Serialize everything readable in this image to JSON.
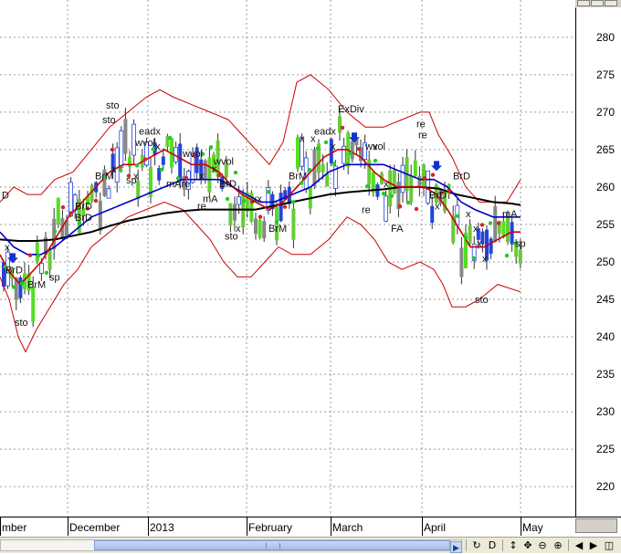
{
  "chart_data": {
    "type": "candlestick",
    "y_axis": {
      "range": [
        216,
        284
      ],
      "ticks": [
        220,
        225,
        230,
        235,
        240,
        245,
        250,
        255,
        260,
        265,
        270,
        275,
        280
      ]
    },
    "x_axis": {
      "labels": [
        "mber",
        "December",
        "2013",
        "February",
        "March",
        "April",
        "May"
      ]
    },
    "grid": "dotted",
    "series": [
      {
        "role": "price",
        "style": "candles"
      },
      {
        "role": "fast_ma",
        "color": "#cc0000",
        "points": [
          [
            0,
            251
          ],
          [
            8,
            249
          ],
          [
            15,
            248
          ],
          [
            22,
            247
          ],
          [
            30,
            248
          ],
          [
            45,
            250
          ],
          [
            60,
            253
          ],
          [
            75,
            256
          ],
          [
            90,
            258
          ],
          [
            105,
            260
          ],
          [
            120,
            262
          ],
          [
            135,
            263
          ],
          [
            150,
            263
          ],
          [
            165,
            264
          ],
          [
            180,
            265
          ],
          [
            195,
            264
          ],
          [
            210,
            263
          ],
          [
            225,
            263
          ],
          [
            240,
            262
          ],
          [
            255,
            260
          ],
          [
            265,
            259
          ],
          [
            280,
            258
          ],
          [
            295,
            257
          ],
          [
            310,
            258
          ],
          [
            325,
            260
          ],
          [
            340,
            262
          ],
          [
            355,
            264
          ],
          [
            370,
            265
          ],
          [
            380,
            265
          ],
          [
            395,
            264
          ],
          [
            410,
            262
          ],
          [
            420,
            261
          ],
          [
            435,
            260
          ],
          [
            450,
            260
          ],
          [
            465,
            260
          ],
          [
            478,
            259
          ],
          [
            490,
            257
          ],
          [
            505,
            254
          ],
          [
            515,
            252
          ],
          [
            530,
            252
          ],
          [
            545,
            253
          ],
          [
            560,
            254
          ],
          [
            570,
            254
          ]
        ]
      },
      {
        "role": "mid_ma",
        "color": "#0000cc",
        "points": [
          [
            0,
            254
          ],
          [
            15,
            252
          ],
          [
            30,
            251
          ],
          [
            45,
            251
          ],
          [
            60,
            252
          ],
          [
            80,
            254
          ],
          [
            100,
            256
          ],
          [
            120,
            257
          ],
          [
            140,
            258
          ],
          [
            160,
            259
          ],
          [
            180,
            260
          ],
          [
            200,
            261
          ],
          [
            220,
            261
          ],
          [
            240,
            261
          ],
          [
            255,
            260
          ],
          [
            270,
            259
          ],
          [
            285,
            258
          ],
          [
            300,
            258
          ],
          [
            320,
            259
          ],
          [
            340,
            260
          ],
          [
            360,
            262
          ],
          [
            380,
            263
          ],
          [
            400,
            263
          ],
          [
            420,
            263
          ],
          [
            440,
            262
          ],
          [
            460,
            261
          ],
          [
            475,
            261
          ],
          [
            490,
            260
          ],
          [
            505,
            258
          ],
          [
            520,
            257
          ],
          [
            540,
            256
          ],
          [
            555,
            256
          ],
          [
            570,
            256
          ]
        ]
      },
      {
        "role": "slow_ma",
        "color": "#000000",
        "points": [
          [
            0,
            253
          ],
          [
            20,
            252.8
          ],
          [
            40,
            252.8
          ],
          [
            60,
            253
          ],
          [
            80,
            253.5
          ],
          [
            100,
            254
          ],
          [
            120,
            254.8
          ],
          [
            140,
            255.5
          ],
          [
            160,
            256
          ],
          [
            180,
            256.5
          ],
          [
            200,
            256.8
          ],
          [
            220,
            257
          ],
          [
            240,
            257
          ],
          [
            260,
            257
          ],
          [
            280,
            257
          ],
          [
            300,
            257.5
          ],
          [
            320,
            258
          ],
          [
            340,
            258.5
          ],
          [
            360,
            259
          ],
          [
            380,
            259.3
          ],
          [
            400,
            259.5
          ],
          [
            420,
            259.7
          ],
          [
            440,
            260
          ],
          [
            460,
            260
          ],
          [
            480,
            259.8
          ],
          [
            500,
            259
          ],
          [
            520,
            258.5
          ],
          [
            540,
            258
          ],
          [
            560,
            257.8
          ],
          [
            570,
            257.6
          ]
        ]
      },
      {
        "role": "upper_band",
        "color": "#cc0000",
        "points": [
          [
            0,
            258
          ],
          [
            15,
            260
          ],
          [
            30,
            259
          ],
          [
            45,
            259
          ],
          [
            60,
            261
          ],
          [
            80,
            262
          ],
          [
            100,
            265
          ],
          [
            120,
            268
          ],
          [
            140,
            270
          ],
          [
            160,
            272
          ],
          [
            175,
            273
          ],
          [
            190,
            272
          ],
          [
            210,
            271
          ],
          [
            230,
            270
          ],
          [
            250,
            269
          ],
          [
            265,
            267
          ],
          [
            280,
            265
          ],
          [
            295,
            263
          ],
          [
            310,
            266
          ],
          [
            325,
            274
          ],
          [
            340,
            275
          ],
          [
            360,
            273
          ],
          [
            380,
            270
          ],
          [
            400,
            268
          ],
          [
            420,
            268
          ],
          [
            440,
            269
          ],
          [
            460,
            270
          ],
          [
            470,
            270
          ],
          [
            480,
            267
          ],
          [
            495,
            264
          ],
          [
            510,
            260
          ],
          [
            525,
            258
          ],
          [
            540,
            258
          ],
          [
            555,
            258
          ],
          [
            570,
            261
          ]
        ]
      },
      {
        "role": "lower_band",
        "color": "#cc0000",
        "points": [
          [
            0,
            248
          ],
          [
            10,
            245
          ],
          [
            20,
            240
          ],
          [
            28,
            238
          ],
          [
            40,
            241
          ],
          [
            55,
            244
          ],
          [
            70,
            247
          ],
          [
            85,
            249
          ],
          [
            100,
            252
          ],
          [
            120,
            254
          ],
          [
            140,
            256
          ],
          [
            160,
            257
          ],
          [
            180,
            258
          ],
          [
            200,
            257
          ],
          [
            215,
            255
          ],
          [
            230,
            253
          ],
          [
            245,
            250
          ],
          [
            260,
            248
          ],
          [
            275,
            248
          ],
          [
            290,
            250
          ],
          [
            305,
            252
          ],
          [
            320,
            251
          ],
          [
            340,
            251
          ],
          [
            360,
            253
          ],
          [
            380,
            256
          ],
          [
            395,
            255
          ],
          [
            410,
            253
          ],
          [
            425,
            250
          ],
          [
            440,
            249
          ],
          [
            460,
            250
          ],
          [
            475,
            249
          ],
          [
            485,
            247
          ],
          [
            495,
            244
          ],
          [
            510,
            244
          ],
          [
            525,
            245
          ],
          [
            545,
            247
          ],
          [
            570,
            246
          ]
        ]
      }
    ],
    "annotations": [
      "D",
      "x",
      "BrD",
      "BrM",
      "sto",
      "sp",
      "BrD",
      "BrD",
      "BrM",
      "x",
      "sp",
      "x",
      "sto",
      "sto",
      "eadx",
      "wvol",
      "x",
      "wvol",
      "mAre",
      "x",
      "x",
      "mA",
      "re",
      "wvol",
      "BrD",
      "sto",
      "x",
      "xx",
      "BrM",
      "BrM",
      "x",
      "x",
      "eadx",
      "x",
      "ExDiv",
      "wvol",
      "x",
      "re",
      "x",
      "FA",
      "re",
      "re",
      "x",
      "BrD",
      "BrD",
      "x",
      "x",
      "x",
      "x",
      "sto",
      "mA",
      "sp"
    ]
  }
}
